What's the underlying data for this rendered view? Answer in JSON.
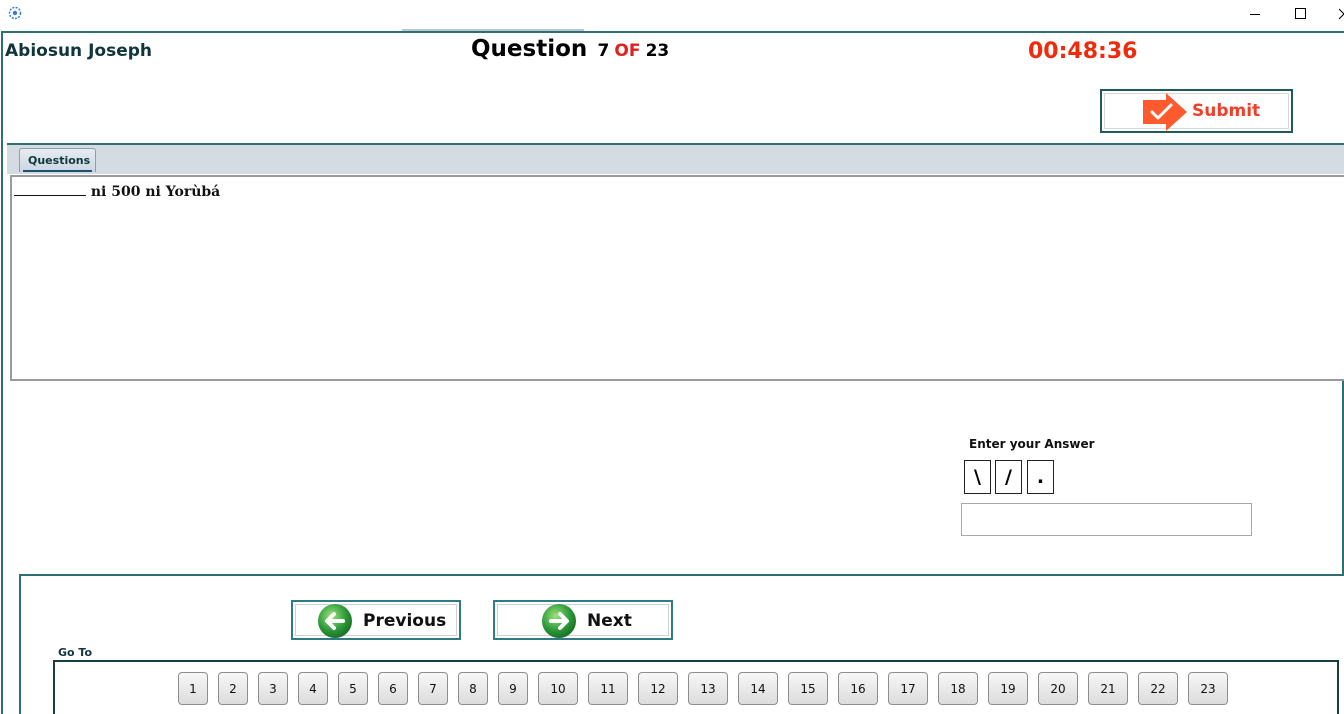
{
  "window": {
    "icons": {
      "app": "app-logo-icon",
      "minimize": "minimize-icon",
      "maximize": "maximize-icon",
      "close": "close-icon"
    }
  },
  "header": {
    "user_name": "Abiosun Joseph",
    "question_label": "Question",
    "current_question": "7",
    "of_label": "OF",
    "total_questions": "23",
    "timer": "00:48:36",
    "submit_label": "Submit",
    "colors": {
      "timer": "#f02b0c",
      "of": "#e02020",
      "submit": "#f0402a",
      "submit_icon": "#ff5a2e"
    }
  },
  "tabs": {
    "questions_label": "Questions"
  },
  "question": {
    "text_after_blank": " ni 500 ni Yorùbá"
  },
  "answer": {
    "prompt": "Enter your Answer",
    "symbols": [
      "\\",
      "/",
      "."
    ],
    "value": "",
    "placeholder": ""
  },
  "navigation": {
    "previous_label": "Previous",
    "next_label": "Next",
    "icons": {
      "previous": "arrow-left-circle-icon",
      "next": "arrow-right-circle-icon"
    },
    "icon_color": "#2e9a3a"
  },
  "goto": {
    "label": "Go To",
    "buttons": [
      "1",
      "2",
      "3",
      "4",
      "5",
      "6",
      "7",
      "8",
      "9",
      "10",
      "11",
      "12",
      "13",
      "14",
      "15",
      "16",
      "17",
      "18",
      "19",
      "20",
      "21",
      "22",
      "23"
    ]
  }
}
